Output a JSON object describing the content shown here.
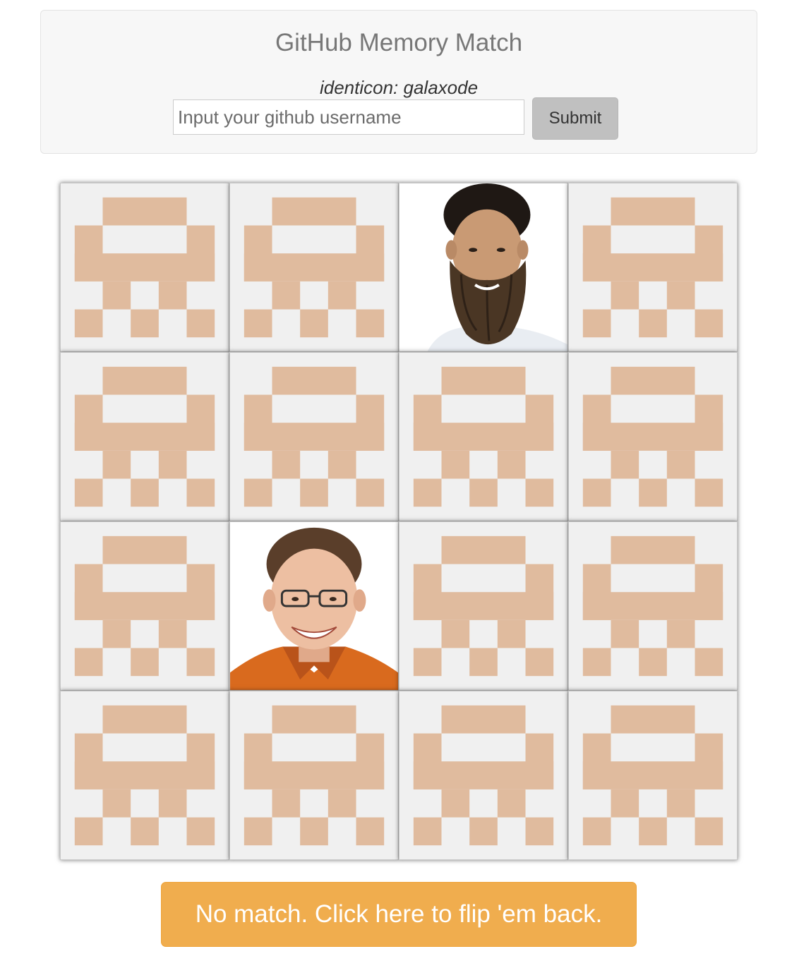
{
  "header": {
    "title": "GitHub Memory Match",
    "identicon_label": "identicon: galaxode",
    "username_placeholder": "Input your github username",
    "username_value": "",
    "submit_label": "Submit"
  },
  "colors": {
    "identicon_fill": "#e0bb9e",
    "card_back": "#f0f0f0",
    "status_button": "#f0ad4e"
  },
  "board": {
    "rows": 4,
    "columns": 4,
    "cards": [
      {
        "state": "face-down",
        "icon": "identicon"
      },
      {
        "state": "face-down",
        "icon": "identicon"
      },
      {
        "state": "face-up",
        "icon": "bearded-man-avatar"
      },
      {
        "state": "face-down",
        "icon": "identicon"
      },
      {
        "state": "face-down",
        "icon": "identicon"
      },
      {
        "state": "face-down",
        "icon": "identicon"
      },
      {
        "state": "face-down",
        "icon": "identicon"
      },
      {
        "state": "face-down",
        "icon": "identicon"
      },
      {
        "state": "face-down",
        "icon": "identicon"
      },
      {
        "state": "face-up",
        "icon": "smiling-man-glasses-avatar"
      },
      {
        "state": "face-down",
        "icon": "identicon"
      },
      {
        "state": "face-down",
        "icon": "identicon"
      },
      {
        "state": "face-down",
        "icon": "identicon"
      },
      {
        "state": "face-down",
        "icon": "identicon"
      },
      {
        "state": "face-down",
        "icon": "identicon"
      },
      {
        "state": "face-down",
        "icon": "identicon"
      }
    ]
  },
  "status": {
    "message": "No match. Click here to flip 'em back."
  }
}
